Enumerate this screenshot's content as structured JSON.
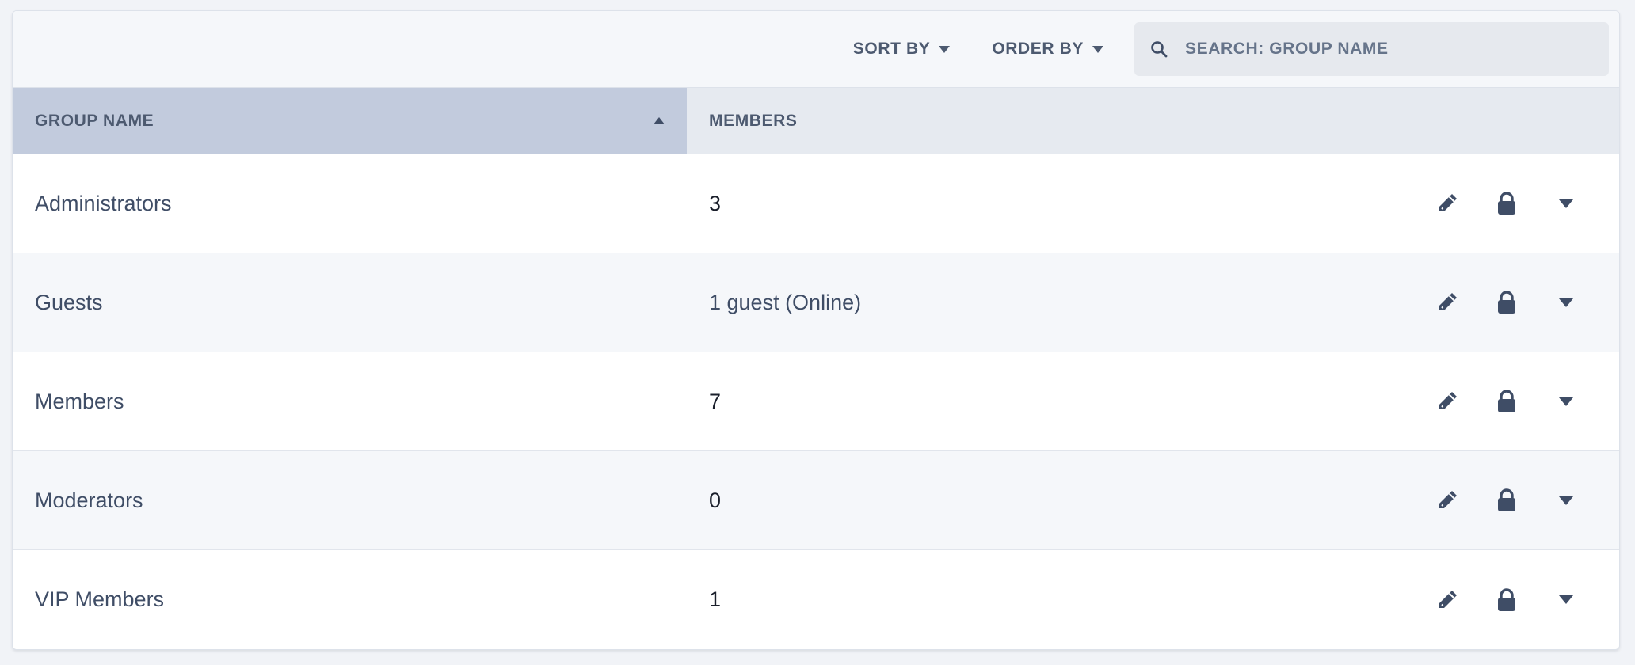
{
  "toolbar": {
    "sort_label": "SORT BY",
    "order_label": "ORDER BY",
    "search_placeholder": "SEARCH: GROUP NAME",
    "search_value": ""
  },
  "table": {
    "columns": [
      "GROUP NAME",
      "MEMBERS"
    ],
    "sorted_column": "GROUP NAME",
    "sort_direction": "ascending",
    "rows": [
      {
        "name": "Administrators",
        "members": "3"
      },
      {
        "name": "Guests",
        "members": "1 guest (Online)"
      },
      {
        "name": "Members",
        "members": "7"
      },
      {
        "name": "Moderators",
        "members": "0"
      },
      {
        "name": "VIP Members",
        "members": "1"
      }
    ],
    "row_actions": [
      "pencil-icon",
      "lock-icon",
      "chevron-down-icon"
    ]
  },
  "colors": {
    "accent_header": "#c2cbdd",
    "text": "#3f4d66",
    "icon": "#3f4d66"
  }
}
